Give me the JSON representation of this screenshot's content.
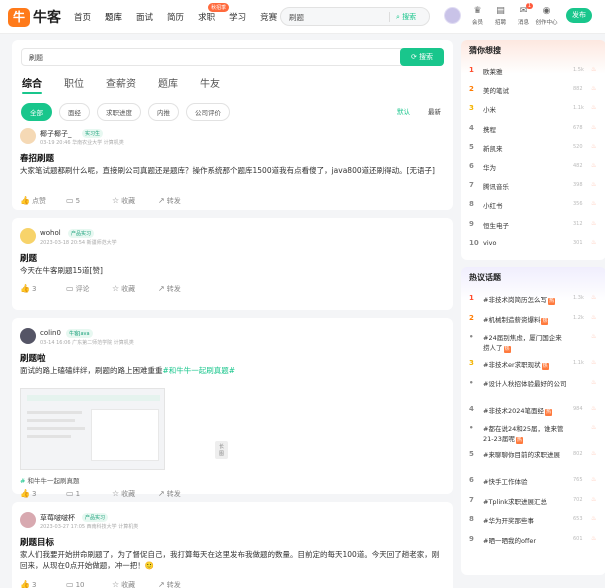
{
  "nav": {
    "logo_mark": "牛",
    "logo_text": "牛客",
    "links": [
      "首页",
      "题库",
      "面试",
      "简历",
      "求职",
      "学习",
      "竞赛"
    ],
    "hot_badge": "秋招季",
    "search_value": "刷题",
    "search_button": "搜索",
    "icons": [
      {
        "label": "会员",
        "icon": "vip-icon",
        "glyph": "♛"
      },
      {
        "label": "招聘",
        "icon": "briefcase-icon",
        "glyph": "▤"
      },
      {
        "label": "消息",
        "icon": "message-icon",
        "glyph": "✉",
        "count": "1"
      },
      {
        "label": "创作中心",
        "icon": "creator-icon",
        "glyph": "◉"
      }
    ],
    "post_button": "发布"
  },
  "search": {
    "value": "刷题",
    "button": "搜索"
  },
  "tabs": [
    "综合",
    "职位",
    "查薪资",
    "题库",
    "牛友"
  ],
  "chips": [
    "全部",
    "面经",
    "求职进度",
    "内推",
    "公司评价"
  ],
  "sorts": [
    "默认",
    "最新"
  ],
  "posts": [
    {
      "user": "椰子椰子_",
      "tag": "实习生",
      "meta": "03-19 20:46  华南农业大学 计算机类",
      "title": "春招刷题",
      "body": "大家笔试题都刷什么呢，直接刷公司真题还是题库？操作系统那个题库1500道我有点看傻了，java800道还刷得动。[无语子]",
      "likes": "点赞",
      "comments": "5",
      "fav": "收藏",
      "share": "转发"
    },
    {
      "user": "wohol",
      "tag": "产品实习",
      "meta": "2023-03-18 20:54  新疆师范大学",
      "title": "刷题",
      "body": "今天在牛客刷题15道[赞]",
      "likes": "3",
      "comments": "评论",
      "fav": "收藏",
      "share": "转发"
    },
    {
      "user": "colin0",
      "tag": "牛客Java",
      "meta": "03-14 16:06  广东第二师范学院 计算机类",
      "title": "刷题啦",
      "body": "面试的路上磕磕绊绊，刷题的路上困难重重",
      "hashtag": "#和牛牛一起刷真题#",
      "img_caption": "长图",
      "topic_prefix": "#",
      "topic": "和牛牛一起刷真题",
      "likes": "3",
      "comments": "1",
      "fav": "收藏",
      "share": "转发"
    },
    {
      "user": "草莓啵啵杯",
      "tag": "产品实习",
      "meta": "2023-03-27 17:05  西南科技大学 计算机类",
      "title": "刷题目标",
      "body": "家人们我要开始拼命刷题了，为了督促自己，我打算每天在这里发布我做题的数量。目前定的每天100道。今天回了趟老家，刚回来，从现在0点开始做题，冲一把！🙂",
      "likes": "3",
      "comments": "10",
      "fav": "收藏",
      "share": "转发"
    }
  ],
  "guess": {
    "title": "猜你想搜",
    "items": [
      {
        "rank": "1",
        "text": "欧莱雅",
        "count": "1.5k"
      },
      {
        "rank": "2",
        "text": "美的笔试",
        "count": "882"
      },
      {
        "rank": "3",
        "text": "小米",
        "count": "1.1k"
      },
      {
        "rank": "4",
        "text": "携程",
        "count": "678"
      },
      {
        "rank": "5",
        "text": "新凯来",
        "count": "520"
      },
      {
        "rank": "6",
        "text": "华为",
        "count": "482"
      },
      {
        "rank": "7",
        "text": "腾讯音乐",
        "count": "398"
      },
      {
        "rank": "8",
        "text": "小红书",
        "count": "356"
      },
      {
        "rank": "9",
        "text": "恒生电子",
        "count": "312"
      },
      {
        "rank": "10",
        "text": "vivo",
        "count": "301"
      }
    ]
  },
  "hot": {
    "title": "热议话题",
    "items": [
      {
        "rank": "1",
        "text": "#非技术岗简历怎么写",
        "count": "1.3k",
        "hot": true
      },
      {
        "rank": "2",
        "text": "#机械制造薪资爆料",
        "count": "1.2k",
        "hot": true
      },
      {
        "rank": "•",
        "text": "#24届别焦虑，厦门国企来捞人了",
        "count": "",
        "hot": true,
        "wrap": true
      },
      {
        "rank": "3",
        "text": "#非技术er求职现状",
        "count": "1.1k",
        "hot": true
      },
      {
        "rank": "•",
        "text": "#设计人秋招体验最好的公司",
        "count": "",
        "hot": false,
        "wrap": true
      },
      {
        "rank": "4",
        "text": "#非技术2024笔面经",
        "count": "984",
        "hot": true
      },
      {
        "rank": "•",
        "text": "#都在说24和25届，谁来管21-23届呢",
        "count": "",
        "hot": true,
        "wrap": true
      },
      {
        "rank": "5",
        "text": "#来聊聊你目前的求职进展",
        "count": "802",
        "hot": false,
        "wrap": true
      },
      {
        "rank": "6",
        "text": "#快手工作体验",
        "count": "765",
        "hot": false
      },
      {
        "rank": "7",
        "text": "#Tplink求职进展汇总",
        "count": "702",
        "hot": false
      },
      {
        "rank": "8",
        "text": "#华为开奖那些事",
        "count": "653",
        "hot": false
      },
      {
        "rank": "9",
        "text": "#晒一晒我的offer",
        "count": "601",
        "hot": false
      }
    ]
  },
  "colors": {
    "accent": "#19c68c",
    "rank1": "#ff4b2b",
    "rank2": "#ff7b00",
    "rank3": "#f3b300"
  }
}
